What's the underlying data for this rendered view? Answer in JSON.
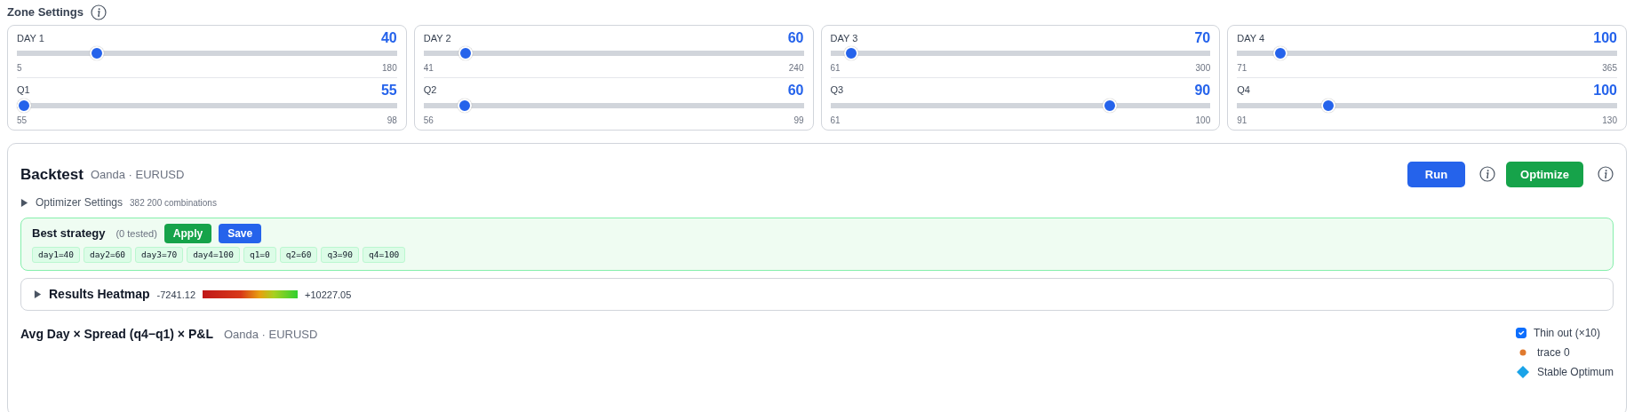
{
  "zone_settings": {
    "title": "Zone Settings",
    "groups": [
      {
        "sliders": [
          {
            "label": "DAY 1",
            "value": "40",
            "min": "5",
            "max": "180",
            "level": 0.2
          },
          {
            "label": "Q1",
            "value": "55",
            "min": "55",
            "max": "98",
            "level": 0
          }
        ]
      },
      {
        "sliders": [
          {
            "label": "DAY 2",
            "value": "60",
            "min": "41",
            "max": "240",
            "level": 0.095
          },
          {
            "label": "Q2",
            "value": "60",
            "min": "56",
            "max": "99",
            "level": 0.093
          }
        ]
      },
      {
        "sliders": [
          {
            "label": "DAY 3",
            "value": "70",
            "min": "61",
            "max": "300",
            "level": 0.038
          },
          {
            "label": "Q3",
            "value": "90",
            "min": "61",
            "max": "100",
            "level": 0.744
          }
        ]
      },
      {
        "sliders": [
          {
            "label": "DAY 4",
            "value": "100",
            "min": "71",
            "max": "365",
            "level": 0.099
          },
          {
            "label": "Q4",
            "value": "100",
            "min": "91",
            "max": "130",
            "level": 0.23
          }
        ]
      }
    ]
  },
  "backtest": {
    "title": "Backtest",
    "subtitle": "Oanda · EURUSD",
    "run_button": "Run",
    "optimize_button": "Optimize",
    "optimizer_settings": {
      "label": "Optimizer Settings",
      "count": "382 200 combinations",
      "expanded": false
    },
    "best_strategy": {
      "title": "Best strategy",
      "tested": "(0 tested)",
      "apply_button": "Apply",
      "save_button": "Save",
      "params": [
        "day1=40",
        "day2=60",
        "day3=70",
        "day4=100",
        "q1=0",
        "q2=60",
        "q3=90",
        "q4=100"
      ]
    },
    "heatmap": {
      "title": "Results Heatmap",
      "expanded": false,
      "min": "-7241.12",
      "max": "+10227.05"
    },
    "plot": {
      "title": "Avg Day × Spread (q4−q1) × P&L",
      "subtitle": "Oanda · EURUSD",
      "thin_out": {
        "label": "Thin out (×10)",
        "checked": true
      },
      "legend": [
        {
          "kind": "dot",
          "label": "trace 0",
          "color": "#e07a2e"
        },
        {
          "kind": "diamond",
          "label": "Stable Optimum",
          "color": "#1aa3e8"
        }
      ]
    }
  }
}
